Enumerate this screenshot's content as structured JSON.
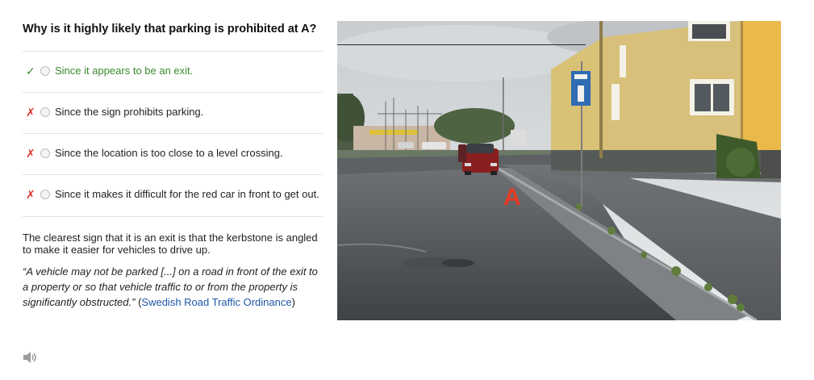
{
  "question": "Why is it highly likely that parking is prohibited at A?",
  "answers": [
    {
      "mark": "✓",
      "status": "correct",
      "text": "Since it appears to be an exit."
    },
    {
      "mark": "✗",
      "status": "incorrect",
      "text": "Since the sign prohibits parking."
    },
    {
      "mark": "✗",
      "status": "incorrect",
      "text": "Since the location is too close to a level crossing."
    },
    {
      "mark": "✗",
      "status": "incorrect",
      "text": "Since it makes it difficult for the red car in front to get out."
    }
  ],
  "explanation": "The clearest sign that it is an exit is that the kerbstone is angled to make it easier for vehicles to drive up.",
  "quote": {
    "text": "“A vehicle may not be parked [...] on a road in front of the exit to a property or so that vehicle traffic to or from the property is significantly obstructed.”",
    "open_paren": " (",
    "source": "Swedish Road Traffic Ordinance",
    "close_paren": ")"
  },
  "photo": {
    "label": "A",
    "label_color": "#e53a25"
  },
  "icons": {
    "speaker": "speaker-icon",
    "correct": "checkmark-icon",
    "incorrect": "cross-icon"
  },
  "colors": {
    "correct": "#3a8a2e",
    "incorrect": "#d9342b",
    "link": "#1f57a8"
  }
}
